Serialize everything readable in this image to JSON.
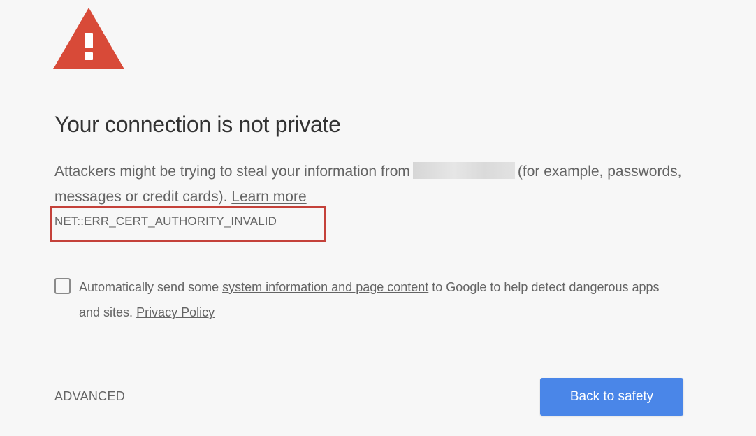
{
  "icon": {
    "name": "warning-triangle-icon",
    "color": "#d84a38"
  },
  "title": "Your connection is not private",
  "message": {
    "prefix": "Attackers might be trying to steal your information from",
    "suffix": "(for example, passwords, messages or credit cards).",
    "learn_more": "Learn more"
  },
  "error_code": "NET::ERR_CERT_AUTHORITY_INVALID",
  "highlight_color": "#c4413a",
  "optin": {
    "checked": false,
    "text_before": "Automatically send some",
    "link1": "system information and page content",
    "text_middle": "to Google to help detect dangerous apps and sites.",
    "link2": "Privacy Policy"
  },
  "buttons": {
    "advanced": "ADVANCED",
    "back_to_safety": "Back to safety",
    "primary_color": "#4a86e8"
  }
}
